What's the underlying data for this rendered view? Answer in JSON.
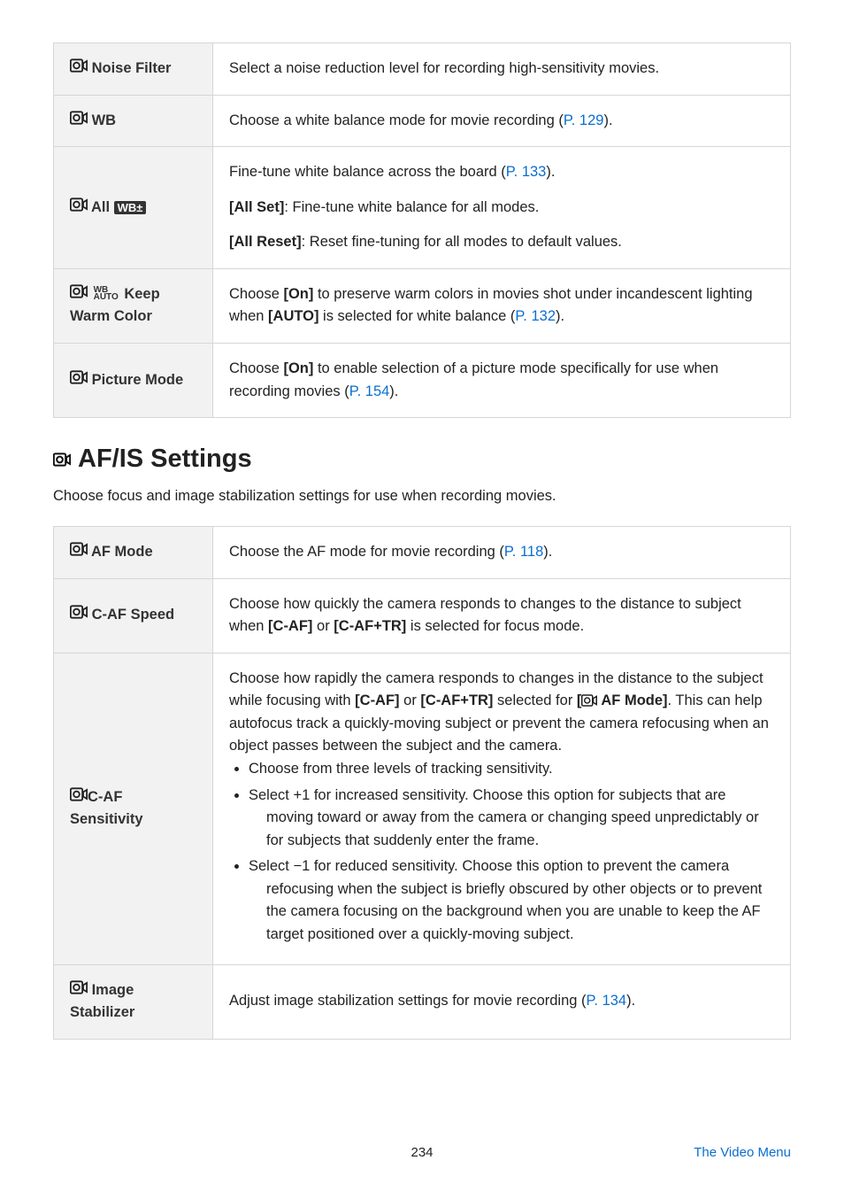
{
  "tables": {
    "spec": [
      {
        "label_parts": [
          "movie",
          " Noise Filter"
        ],
        "body_html": "Select a noise reduction level for recording high-sensitivity movies."
      },
      {
        "label_parts": [
          "movie",
          " WB"
        ],
        "body_html": "Choose a white balance mode for movie recording (<span class='link'>P. 129</span>)."
      },
      {
        "label_parts": [
          "movie",
          " All ",
          "wbz"
        ],
        "body_html": "<p>Fine-tune white balance across the board (<span class='link'>P. 133</span>).</p><p><b>[All Set]</b>: Fine-tune white balance for all modes.</p><p><b>[All Reset]</b>: Reset fine-tuning for all modes to default values.</p>"
      },
      {
        "label_parts": [
          "movie",
          "wbauto",
          " Keep Warm Color"
        ],
        "body_html": "Choose <b>[On]</b> to preserve warm colors in movies shot under incandescent lighting when <b>[AUTO]</b> is selected for white balance (<span class='link'>P. 132</span>)."
      },
      {
        "label_parts": [
          "movie",
          " Picture Mode"
        ],
        "body_html": "Choose <b>[On]</b> to enable selection of a picture mode specifically for use when recording movies (<span class='link'>P. 154</span>)."
      }
    ],
    "afis": [
      {
        "label_parts": [
          "movie",
          " AF Mode"
        ],
        "body_html": "Choose the AF mode for movie recording (<span class='link'>P. 118</span>)."
      },
      {
        "label_parts": [
          "movie",
          " C-AF Speed"
        ],
        "body_html": "Choose how quickly the camera responds to changes to the distance to subject when <b>[C-AF]</b> or <b>[C-AF+TR]</b> is selected for focus mode."
      },
      {
        "label_parts": [
          "movie",
          "C-AF Sensitivity"
        ],
        "body_html": "Choose how rapidly the camera responds to changes in the distance to the subject while focusing with <b>[C-AF]</b> or <b>[C-AF+TR]</b> selected for <b>[<svg style='width:18px;height:14px;vertical-align:-2px' viewBox='0 0 24 18'><rect x='1' y='1' width='16' height='16' rx='2' fill='none' stroke='#222' stroke-width='2'/><circle cx='9' cy='9' r='4' fill='none' stroke='#222' stroke-width='2'/><path d='M18 6 L23 3 L23 15 L18 12 Z' fill='none' stroke='#222' stroke-width='2'/></svg> AF Mode]</b>. This can help autofocus track a quickly-moving subject or prevent the camera refocusing when an object passes between the subject and the camera.<ul class='bullets'><li>Choose from three levels of tracking sensitivity.</li><li>Select +1 for increased sensitivity. Choose this option for subjects that are <span class='indent-cont'>moving toward or away from the camera or changing speed unpredictably or for subjects that suddenly enter the frame.</span></li><li>Select −1 for reduced sensitivity. Choose this option to prevent the camera <span class='indent-cont'>refocusing when the subject is briefly obscured by other objects or to prevent the camera focusing on the background when you are unable to keep the AF target positioned over a quickly-moving subject.</span></li></ul>"
      },
      {
        "label_parts": [
          "movie",
          " Image Stabilizer"
        ],
        "body_html": "Adjust image stabilization settings for movie recording (<span class='link'>P. 134</span>)."
      }
    ]
  },
  "heading": "AF/IS Settings",
  "intro": "Choose focus and image stabilization settings for use when recording movies.",
  "footer": {
    "page": "234",
    "section": "The Video Menu"
  }
}
